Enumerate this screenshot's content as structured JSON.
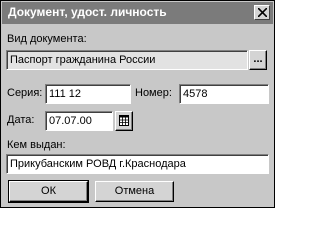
{
  "window": {
    "title": "Документ, удост. личность"
  },
  "doc_type": {
    "label": "Вид документа:",
    "value": "Паспорт гражданина России",
    "browse_label": "..."
  },
  "series": {
    "label": "Серия:",
    "value": "111 12"
  },
  "number": {
    "label": "Номер:",
    "value": "4578"
  },
  "date": {
    "label": "Дата:",
    "value": "07.07.00"
  },
  "issued_by": {
    "label": "Кем выдан:",
    "value": "Прикубанским РОВД г.Краснодара"
  },
  "buttons": {
    "ok": "ОК",
    "cancel": "Отмена"
  },
  "icons": {
    "close": "close-icon",
    "calendar": "calendar-icon"
  }
}
